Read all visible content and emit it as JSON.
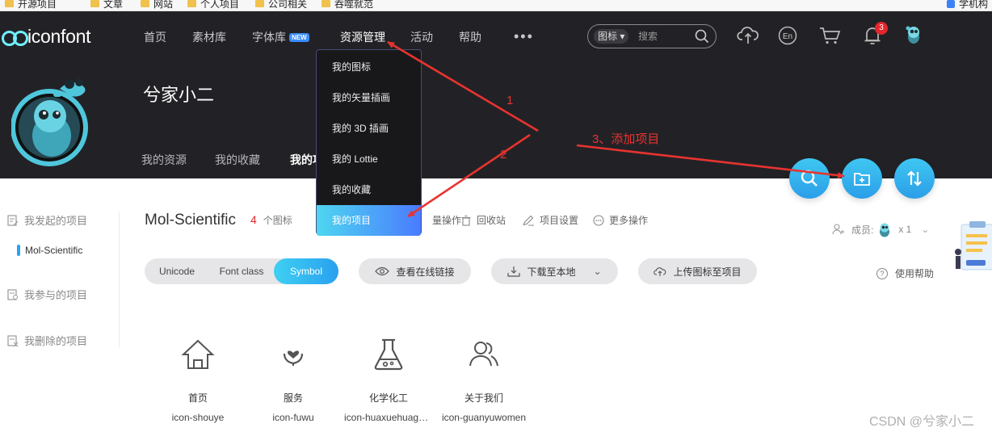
{
  "bookmarks": [
    {
      "label": "开源项目"
    },
    {
      "label": "文章"
    },
    {
      "label": "网站"
    },
    {
      "label": "个人项目"
    },
    {
      "label": "公司相关"
    },
    {
      "label": "吞噬就范"
    },
    {
      "label": "学机构"
    }
  ],
  "header": {
    "logo_text": "iconfont",
    "nav": [
      "首页",
      "素材库",
      "字体库",
      "资源管理",
      "活动",
      "帮助"
    ],
    "new_badge": "NEW",
    "search": {
      "type_label": "图标",
      "placeholder": "搜索"
    },
    "notification_count": "3",
    "username": "兮家小二",
    "subtabs": [
      "我的资源",
      "我的收藏",
      "我的项"
    ]
  },
  "dropdown": {
    "items": [
      "我的图标",
      "我的矢量插画",
      "我的 3D 插画",
      "我的 Lottie",
      "我的收藏",
      "我的项目"
    ],
    "active_index": 5
  },
  "sidebar": {
    "my_projects": "我发起的项目",
    "current_project": "Mol-Scientific",
    "joined_projects": "我参与的项目",
    "deleted_projects": "我删除的项目"
  },
  "project": {
    "title": "Mol-Scientific",
    "icon_count": "4",
    "icon_count_suffix": "个图标",
    "actions": [
      "量操作",
      "回收站",
      "项目设置",
      "更多操作"
    ],
    "members_label": "成员:",
    "members_count": "x 1"
  },
  "toolbar": {
    "modes": [
      "Unicode",
      "Font class",
      "Symbol"
    ],
    "active_mode": "Symbol",
    "view_link": "查看在线链接",
    "download": "下载至本地",
    "upload": "上传图标至项目",
    "help": "使用帮助"
  },
  "icons": [
    {
      "name": "首页",
      "code": "icon-shouye",
      "icon": "home-icon"
    },
    {
      "name": "服务",
      "code": "icon-fuwu",
      "icon": "service-hands-heart-icon"
    },
    {
      "name": "化学化工",
      "code": "icon-huaxuehuagong",
      "icon": "flask-icon"
    },
    {
      "name": "关于我们",
      "code": "icon-guanyuwomen",
      "icon": "users-icon"
    }
  ],
  "annotations": {
    "one": "1",
    "two": "2",
    "three": "3、添加项目"
  },
  "watermark": "CSDN @兮家小二",
  "colors": {
    "header_bg": "#222226",
    "accent": "#2aa3f1",
    "annotation": "#e8332f",
    "badge_red": "#e4262c"
  }
}
